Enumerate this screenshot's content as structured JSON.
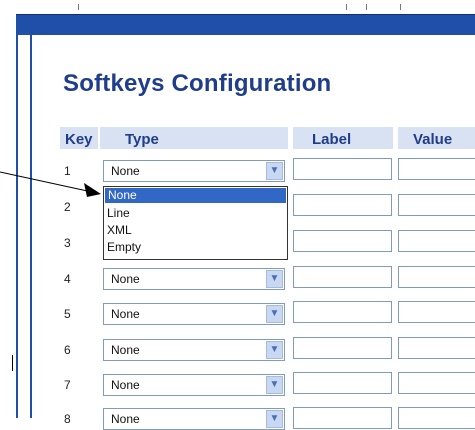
{
  "page": {
    "title": "Softkeys Configuration"
  },
  "table": {
    "headers": {
      "key": "Key",
      "type": "Type",
      "label": "Label",
      "value": "Value"
    },
    "rows": [
      {
        "key": "1",
        "type": "None"
      },
      {
        "key": "2",
        "type": ""
      },
      {
        "key": "3",
        "type": ""
      },
      {
        "key": "4",
        "type": "None"
      },
      {
        "key": "5",
        "type": "None"
      },
      {
        "key": "6",
        "type": "None"
      },
      {
        "key": "7",
        "type": "None"
      },
      {
        "key": "8",
        "type": "None"
      }
    ]
  },
  "dropdown": {
    "options": [
      "None",
      "Line",
      "XML",
      "Empty"
    ],
    "selected": "None"
  },
  "icons": {
    "select_arrow": "chevron-down-icon",
    "pointer_arrow": "arrow-pointer-icon"
  },
  "colors": {
    "header_bar": "#1f4fa8",
    "title_text": "#1f3d8a",
    "header_cell_bg": "#d9e2f2",
    "selection": "#3167c5"
  }
}
